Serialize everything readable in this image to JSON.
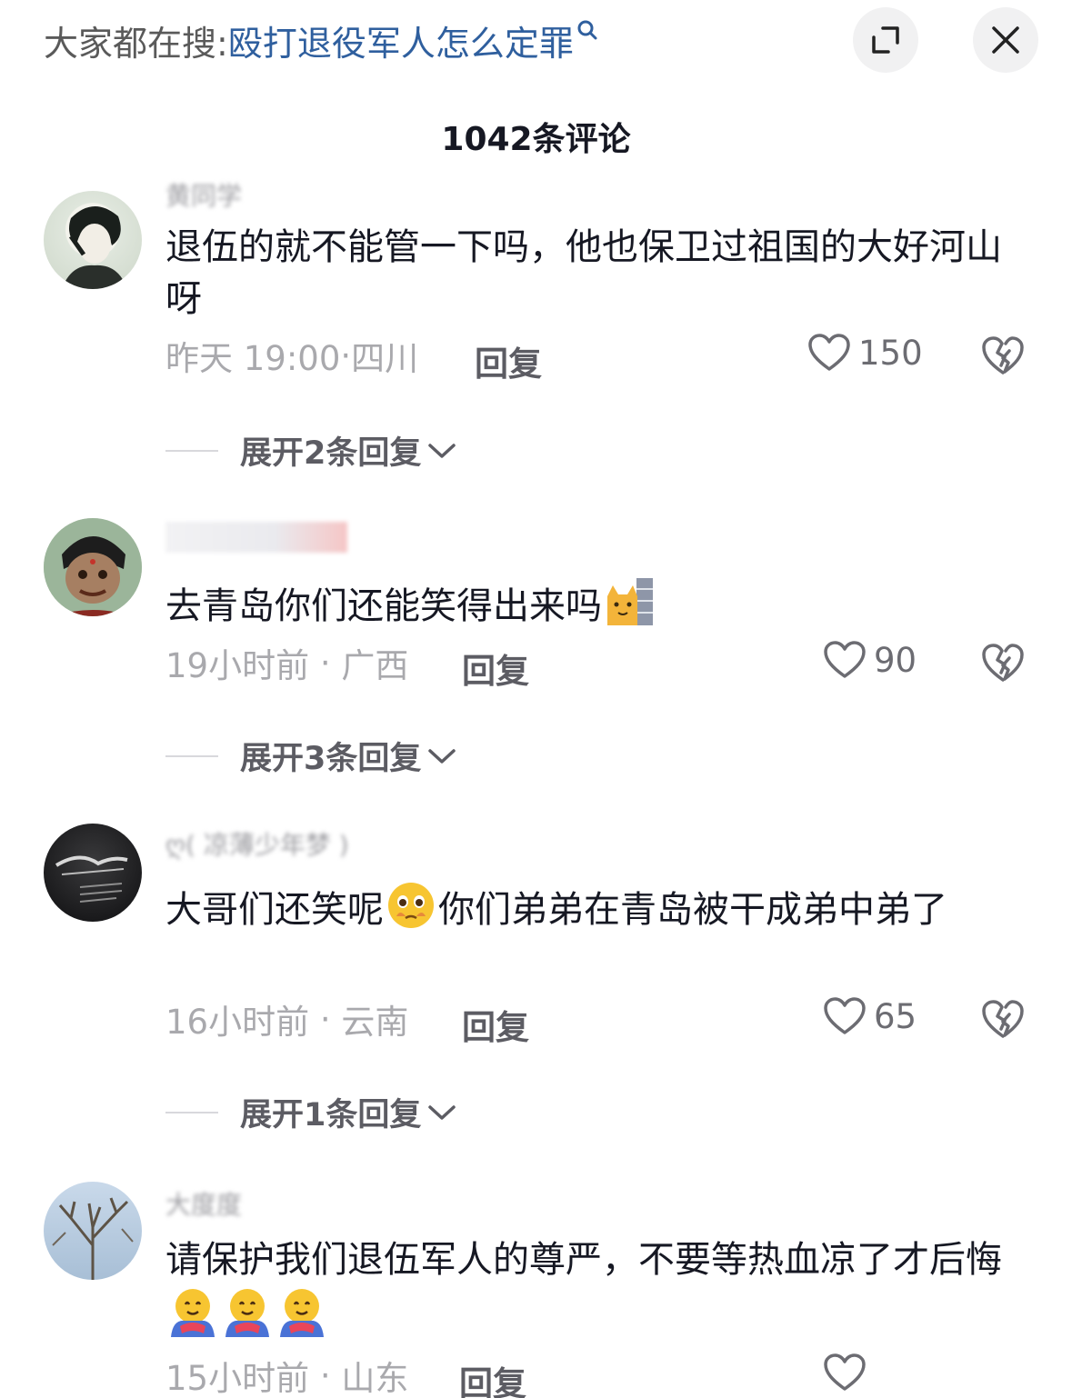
{
  "search": {
    "prefix": "大家都在搜:",
    "query": "殴打退役军人怎么定罪"
  },
  "header": {
    "title": "1042条评论"
  },
  "colors": {
    "link": "#2f5f9e",
    "text": "#161823",
    "meta": "#a9a9ad"
  },
  "comments": [
    {
      "username": "黄同学",
      "text": "退伍的就不能管一下吗，他也保卫过祖国的大好河山呀",
      "time": "昨天 19:00",
      "location": "四川",
      "reply_label": "回复",
      "likes": "150",
      "expand": "展开2条回复"
    },
    {
      "username": "",
      "text": "去青岛你们还能笑得出来吗",
      "time": "19小时前",
      "location": "广西",
      "reply_label": "回复",
      "likes": "90",
      "expand": "展开3条回复"
    },
    {
      "username": "ღ( 凉薄少年梦 )",
      "text_a": "大哥们还笑呢",
      "text_b": "你们弟弟在青岛被干成弟中弟了",
      "time": "16小时前",
      "location": "云南",
      "reply_label": "回复",
      "likes": "65",
      "expand": "展开1条回复"
    },
    {
      "username": "大度度",
      "text": "请保护我们退伍军人的尊严，不要等热血凉了才后悔",
      "time": "15小时前",
      "location": "山东",
      "reply_label": "回复"
    }
  ]
}
